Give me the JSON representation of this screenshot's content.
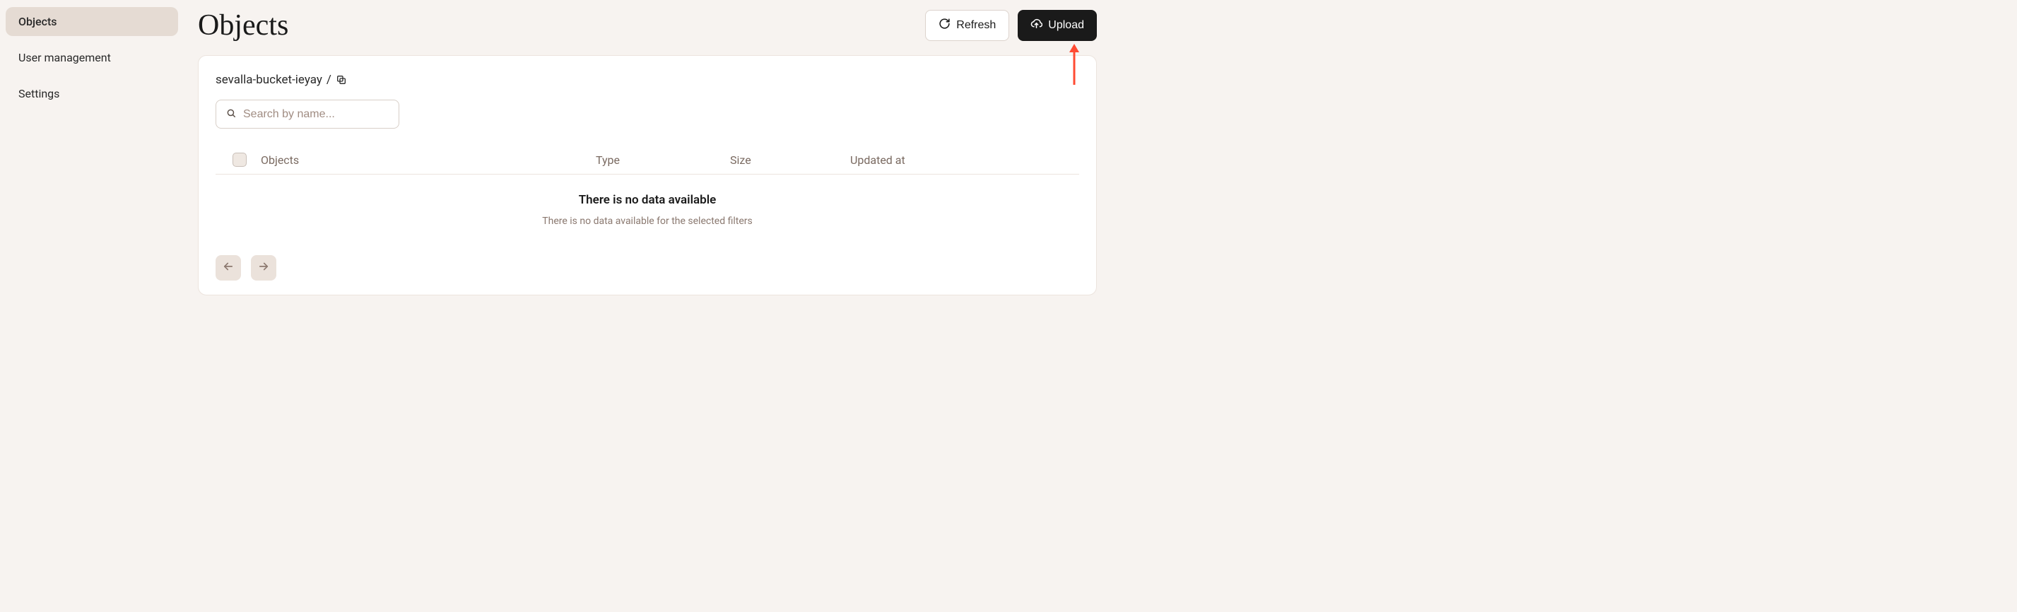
{
  "sidebar": {
    "items": [
      {
        "label": "Objects",
        "active": true
      },
      {
        "label": "User management",
        "active": false
      },
      {
        "label": "Settings",
        "active": false
      }
    ]
  },
  "header": {
    "title": "Objects",
    "refresh_label": "Refresh",
    "upload_label": "Upload"
  },
  "breadcrumb": {
    "bucket": "sevalla-bucket-ieyay",
    "sep": "/"
  },
  "search": {
    "placeholder": "Search by name..."
  },
  "table": {
    "columns": {
      "objects": "Objects",
      "type": "Type",
      "size": "Size",
      "updated": "Updated at"
    },
    "empty_title": "There is no data available",
    "empty_sub": "There is no data available for the selected filters"
  }
}
